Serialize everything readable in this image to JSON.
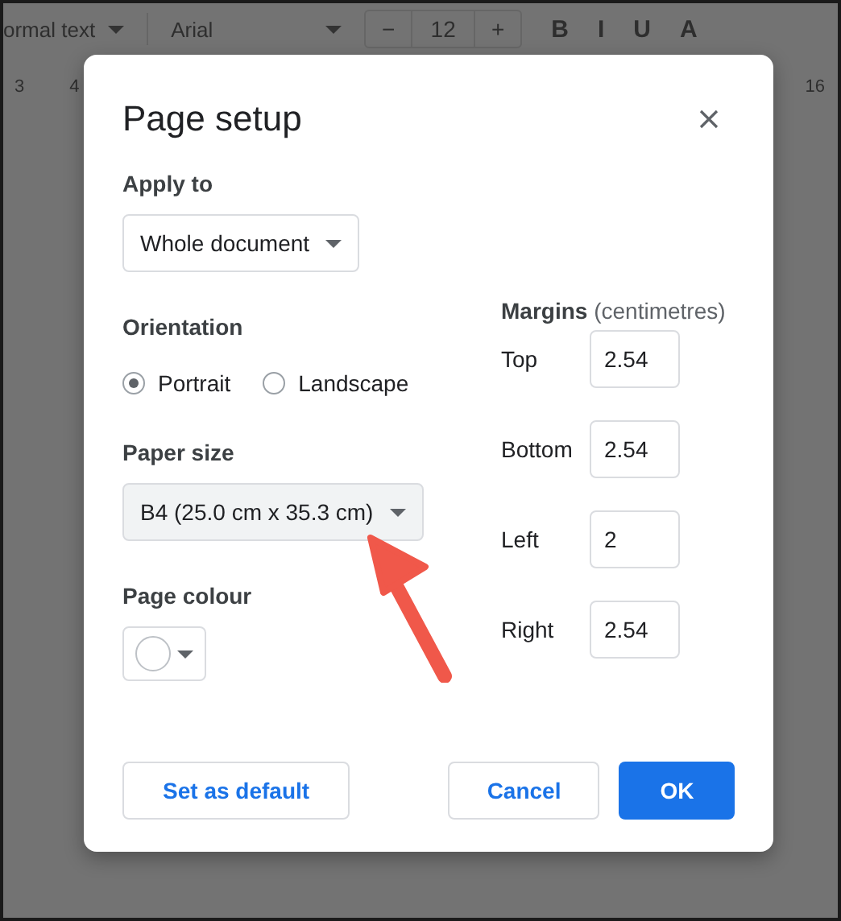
{
  "background": {
    "toolbar": {
      "style": "ormal text",
      "font": "Arial",
      "decrease": "−",
      "size": "12",
      "increase": "+",
      "format_buttons": [
        "B",
        "I",
        "U",
        "A"
      ]
    },
    "ruler": [
      "3",
      "4",
      "16"
    ]
  },
  "dialog": {
    "title": "Page setup",
    "apply_to": {
      "label": "Apply to",
      "value": "Whole document"
    },
    "orientation": {
      "label": "Orientation",
      "options": [
        {
          "label": "Portrait",
          "selected": true
        },
        {
          "label": "Landscape",
          "selected": false
        }
      ]
    },
    "paper_size": {
      "label": "Paper size",
      "value": "B4 (25.0 cm x 35.3 cm)"
    },
    "page_colour": {
      "label": "Page colour"
    },
    "margins": {
      "label": "Margins",
      "unit": "(centimetres)",
      "fields": [
        {
          "label": "Top",
          "value": "2.54"
        },
        {
          "label": "Bottom",
          "value": "2.54"
        },
        {
          "label": "Left",
          "value": "2"
        },
        {
          "label": "Right",
          "value": "2.54"
        }
      ]
    },
    "buttons": [
      {
        "label": "Set as default",
        "kind": "secondary"
      },
      {
        "label": "Cancel",
        "kind": "secondary"
      },
      {
        "label": "OK",
        "kind": "primary"
      }
    ]
  }
}
